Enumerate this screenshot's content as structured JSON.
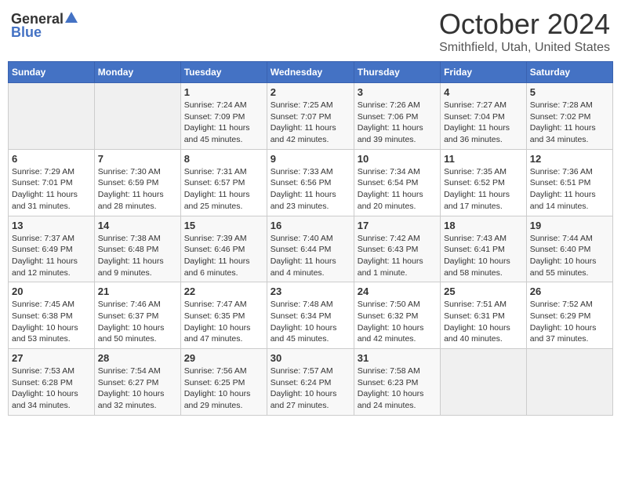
{
  "header": {
    "logo_general": "General",
    "logo_blue": "Blue",
    "month_title": "October 2024",
    "location": "Smithfield, Utah, United States"
  },
  "weekdays": [
    "Sunday",
    "Monday",
    "Tuesday",
    "Wednesday",
    "Thursday",
    "Friday",
    "Saturday"
  ],
  "weeks": [
    [
      {
        "day": "",
        "sunrise": "",
        "sunset": "",
        "daylight": ""
      },
      {
        "day": "",
        "sunrise": "",
        "sunset": "",
        "daylight": ""
      },
      {
        "day": "1",
        "sunrise": "Sunrise: 7:24 AM",
        "sunset": "Sunset: 7:09 PM",
        "daylight": "Daylight: 11 hours and 45 minutes."
      },
      {
        "day": "2",
        "sunrise": "Sunrise: 7:25 AM",
        "sunset": "Sunset: 7:07 PM",
        "daylight": "Daylight: 11 hours and 42 minutes."
      },
      {
        "day": "3",
        "sunrise": "Sunrise: 7:26 AM",
        "sunset": "Sunset: 7:06 PM",
        "daylight": "Daylight: 11 hours and 39 minutes."
      },
      {
        "day": "4",
        "sunrise": "Sunrise: 7:27 AM",
        "sunset": "Sunset: 7:04 PM",
        "daylight": "Daylight: 11 hours and 36 minutes."
      },
      {
        "day": "5",
        "sunrise": "Sunrise: 7:28 AM",
        "sunset": "Sunset: 7:02 PM",
        "daylight": "Daylight: 11 hours and 34 minutes."
      }
    ],
    [
      {
        "day": "6",
        "sunrise": "Sunrise: 7:29 AM",
        "sunset": "Sunset: 7:01 PM",
        "daylight": "Daylight: 11 hours and 31 minutes."
      },
      {
        "day": "7",
        "sunrise": "Sunrise: 7:30 AM",
        "sunset": "Sunset: 6:59 PM",
        "daylight": "Daylight: 11 hours and 28 minutes."
      },
      {
        "day": "8",
        "sunrise": "Sunrise: 7:31 AM",
        "sunset": "Sunset: 6:57 PM",
        "daylight": "Daylight: 11 hours and 25 minutes."
      },
      {
        "day": "9",
        "sunrise": "Sunrise: 7:33 AM",
        "sunset": "Sunset: 6:56 PM",
        "daylight": "Daylight: 11 hours and 23 minutes."
      },
      {
        "day": "10",
        "sunrise": "Sunrise: 7:34 AM",
        "sunset": "Sunset: 6:54 PM",
        "daylight": "Daylight: 11 hours and 20 minutes."
      },
      {
        "day": "11",
        "sunrise": "Sunrise: 7:35 AM",
        "sunset": "Sunset: 6:52 PM",
        "daylight": "Daylight: 11 hours and 17 minutes."
      },
      {
        "day": "12",
        "sunrise": "Sunrise: 7:36 AM",
        "sunset": "Sunset: 6:51 PM",
        "daylight": "Daylight: 11 hours and 14 minutes."
      }
    ],
    [
      {
        "day": "13",
        "sunrise": "Sunrise: 7:37 AM",
        "sunset": "Sunset: 6:49 PM",
        "daylight": "Daylight: 11 hours and 12 minutes."
      },
      {
        "day": "14",
        "sunrise": "Sunrise: 7:38 AM",
        "sunset": "Sunset: 6:48 PM",
        "daylight": "Daylight: 11 hours and 9 minutes."
      },
      {
        "day": "15",
        "sunrise": "Sunrise: 7:39 AM",
        "sunset": "Sunset: 6:46 PM",
        "daylight": "Daylight: 11 hours and 6 minutes."
      },
      {
        "day": "16",
        "sunrise": "Sunrise: 7:40 AM",
        "sunset": "Sunset: 6:44 PM",
        "daylight": "Daylight: 11 hours and 4 minutes."
      },
      {
        "day": "17",
        "sunrise": "Sunrise: 7:42 AM",
        "sunset": "Sunset: 6:43 PM",
        "daylight": "Daylight: 11 hours and 1 minute."
      },
      {
        "day": "18",
        "sunrise": "Sunrise: 7:43 AM",
        "sunset": "Sunset: 6:41 PM",
        "daylight": "Daylight: 10 hours and 58 minutes."
      },
      {
        "day": "19",
        "sunrise": "Sunrise: 7:44 AM",
        "sunset": "Sunset: 6:40 PM",
        "daylight": "Daylight: 10 hours and 55 minutes."
      }
    ],
    [
      {
        "day": "20",
        "sunrise": "Sunrise: 7:45 AM",
        "sunset": "Sunset: 6:38 PM",
        "daylight": "Daylight: 10 hours and 53 minutes."
      },
      {
        "day": "21",
        "sunrise": "Sunrise: 7:46 AM",
        "sunset": "Sunset: 6:37 PM",
        "daylight": "Daylight: 10 hours and 50 minutes."
      },
      {
        "day": "22",
        "sunrise": "Sunrise: 7:47 AM",
        "sunset": "Sunset: 6:35 PM",
        "daylight": "Daylight: 10 hours and 47 minutes."
      },
      {
        "day": "23",
        "sunrise": "Sunrise: 7:48 AM",
        "sunset": "Sunset: 6:34 PM",
        "daylight": "Daylight: 10 hours and 45 minutes."
      },
      {
        "day": "24",
        "sunrise": "Sunrise: 7:50 AM",
        "sunset": "Sunset: 6:32 PM",
        "daylight": "Daylight: 10 hours and 42 minutes."
      },
      {
        "day": "25",
        "sunrise": "Sunrise: 7:51 AM",
        "sunset": "Sunset: 6:31 PM",
        "daylight": "Daylight: 10 hours and 40 minutes."
      },
      {
        "day": "26",
        "sunrise": "Sunrise: 7:52 AM",
        "sunset": "Sunset: 6:29 PM",
        "daylight": "Daylight: 10 hours and 37 minutes."
      }
    ],
    [
      {
        "day": "27",
        "sunrise": "Sunrise: 7:53 AM",
        "sunset": "Sunset: 6:28 PM",
        "daylight": "Daylight: 10 hours and 34 minutes."
      },
      {
        "day": "28",
        "sunrise": "Sunrise: 7:54 AM",
        "sunset": "Sunset: 6:27 PM",
        "daylight": "Daylight: 10 hours and 32 minutes."
      },
      {
        "day": "29",
        "sunrise": "Sunrise: 7:56 AM",
        "sunset": "Sunset: 6:25 PM",
        "daylight": "Daylight: 10 hours and 29 minutes."
      },
      {
        "day": "30",
        "sunrise": "Sunrise: 7:57 AM",
        "sunset": "Sunset: 6:24 PM",
        "daylight": "Daylight: 10 hours and 27 minutes."
      },
      {
        "day": "31",
        "sunrise": "Sunrise: 7:58 AM",
        "sunset": "Sunset: 6:23 PM",
        "daylight": "Daylight: 10 hours and 24 minutes."
      },
      {
        "day": "",
        "sunrise": "",
        "sunset": "",
        "daylight": ""
      },
      {
        "day": "",
        "sunrise": "",
        "sunset": "",
        "daylight": ""
      }
    ]
  ]
}
